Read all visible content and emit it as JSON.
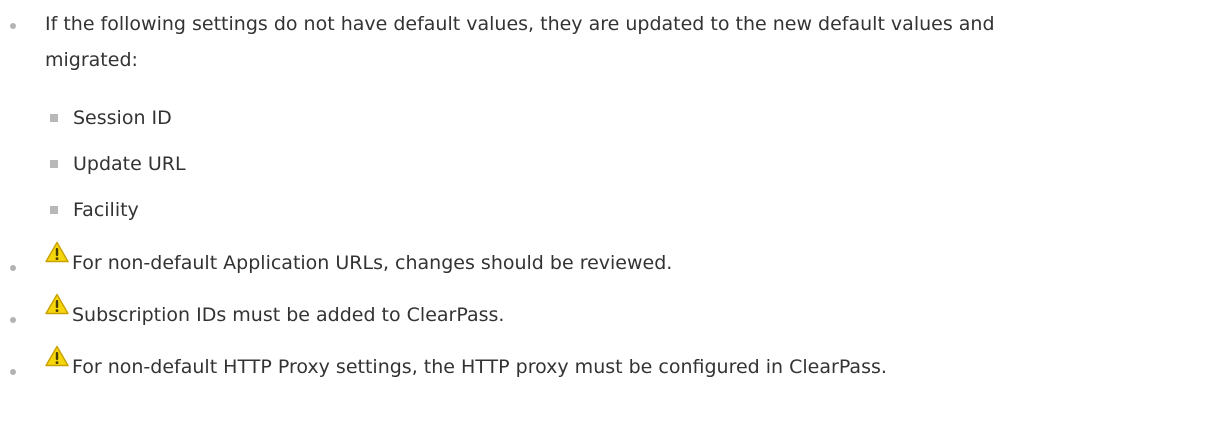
{
  "intro": {
    "line1": "If the following settings do not have default values, they are updated to the new default values and",
    "line2": "migrated:"
  },
  "settings": [
    {
      "label": "Session ID"
    },
    {
      "label": "Update URL"
    },
    {
      "label": "Facility"
    }
  ],
  "warnings": [
    {
      "text": "For non-default Application URLs, changes should be reviewed.",
      "icon": "warning-icon"
    },
    {
      "text": "Subscription IDs must be added to ClearPass.",
      "icon": "warning-icon"
    },
    {
      "text": "For non-default HTTP Proxy settings, the HTTP proxy must be configured in ClearPass.",
      "icon": "warning-icon"
    }
  ],
  "colors": {
    "text": "#333333",
    "bullet": "#b3b3b3",
    "warning_fill": "#f5d60a",
    "warning_stroke": "#c9a100"
  }
}
